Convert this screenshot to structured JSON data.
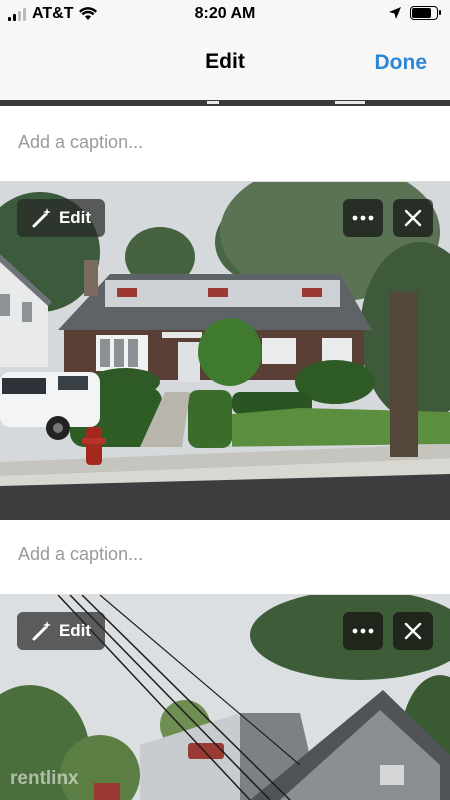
{
  "status_bar": {
    "carrier": "AT&T",
    "time": "8:20 AM",
    "battery_level": 0.85,
    "icons": [
      "signal-bars-icon",
      "wifi-icon",
      "location-arrow-icon",
      "battery-icon"
    ]
  },
  "nav": {
    "title": "Edit",
    "done_label": "Done",
    "accent_color": "#2d87d8"
  },
  "items": [
    {
      "caption_placeholder": "Add a caption...",
      "edit_label": "Edit",
      "buttons": [
        "magic-wand-icon",
        "more-icon",
        "close-icon"
      ]
    },
    {
      "caption_placeholder": "Add a caption...",
      "edit_label": "Edit",
      "buttons": [
        "magic-wand-icon",
        "more-icon",
        "close-icon"
      ]
    }
  ],
  "watermark": "rentlinx"
}
